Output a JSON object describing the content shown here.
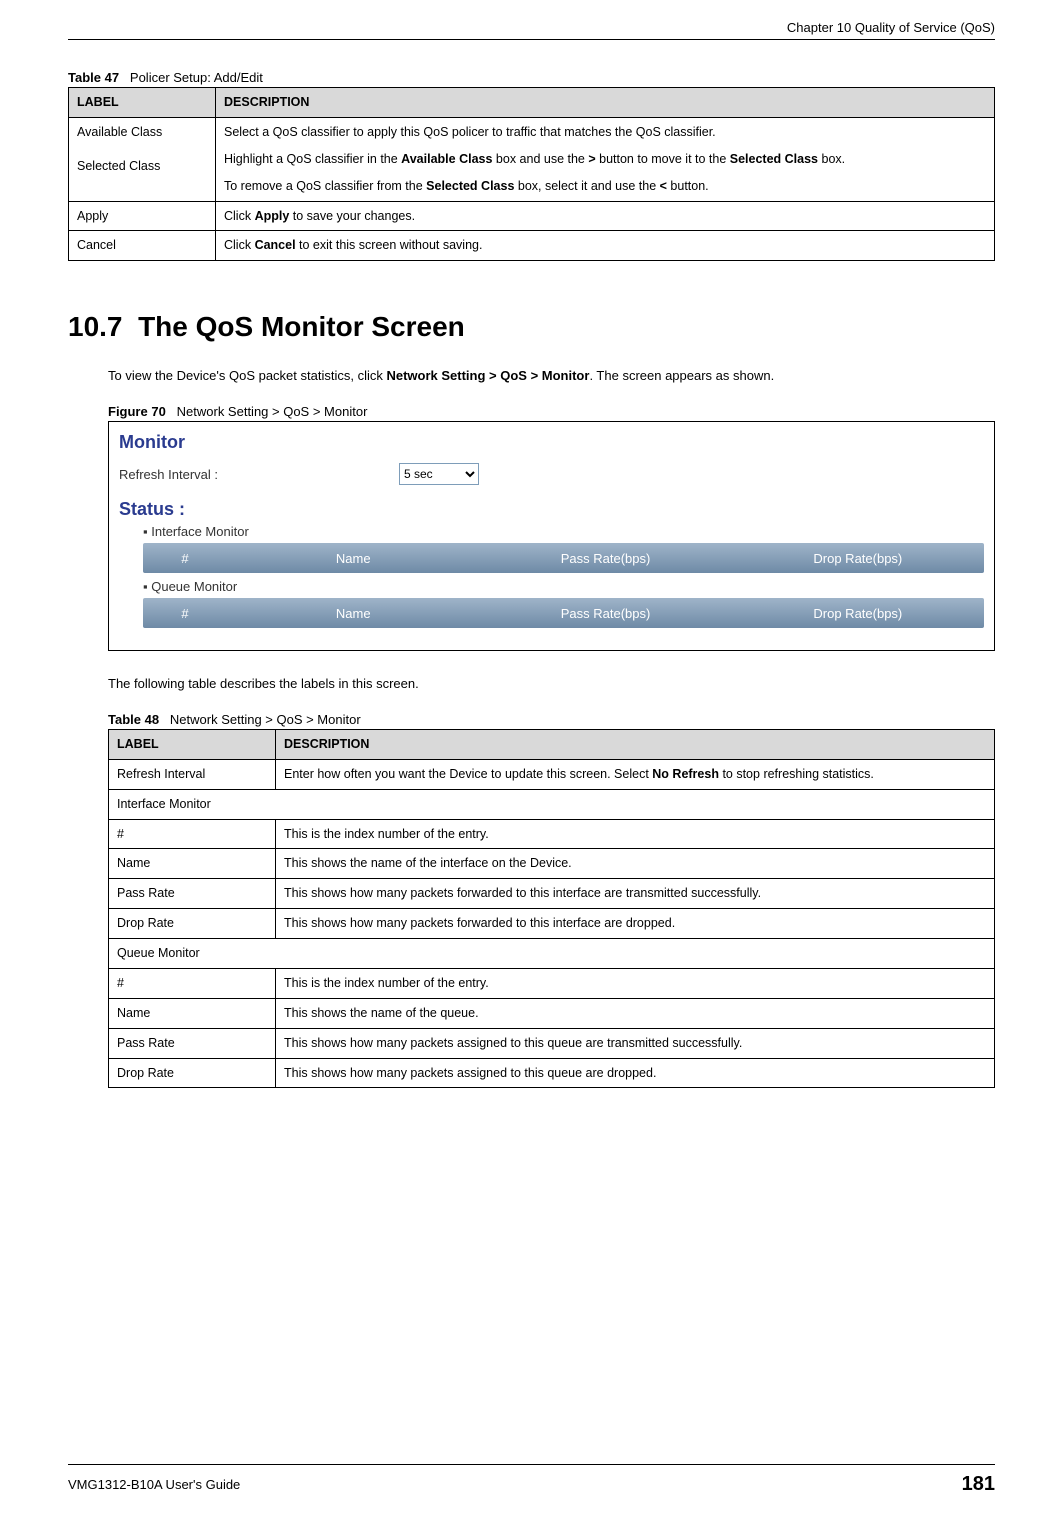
{
  "header": {
    "chapter": "Chapter 10 Quality of Service (QoS)"
  },
  "table47": {
    "caption_prefix": "Table 47",
    "caption_title": "Policer Setup: Add/Edit",
    "head": {
      "label": "LABEL",
      "desc": "DESCRIPTION"
    },
    "rows": {
      "r1": {
        "label1": "Available Class",
        "label2": "Selected Class",
        "p1": "Select a QoS classifier to apply this QoS policer to traffic that matches the QoS classifier.",
        "p2a": "Highlight a QoS classifier in the ",
        "p2b": "Available Class",
        "p2c": " box and use the ",
        "p2d": ">",
        "p2e": " button to move it to the ",
        "p2f": "Selected Class",
        "p2g": " box.",
        "p3a": "To remove a QoS classifier from the ",
        "p3b": "Selected Class",
        "p3c": " box, select it and use the ",
        "p3d": "<",
        "p3e": " button."
      },
      "r2": {
        "label": "Apply",
        "d1": "Click ",
        "d2": "Apply",
        "d3": " to save your changes."
      },
      "r3": {
        "label": "Cancel",
        "d1": "Click ",
        "d2": "Cancel",
        "d3": " to exit this screen without saving."
      }
    }
  },
  "section": {
    "number": "10.7",
    "title": "The QoS Monitor Screen",
    "intro1": "To view the Device's QoS packet statistics, click ",
    "intro_bold": "Network Setting > QoS > Monitor",
    "intro2": ". The screen appears as shown."
  },
  "figure70": {
    "caption_prefix": "Figure 70",
    "caption_title": "Network Setting > QoS > Monitor",
    "window": {
      "title": "Monitor",
      "refresh_label": "Refresh Interval :",
      "refresh_value": "5 sec",
      "status_label": "Status :",
      "interface_monitor": "Interface Monitor",
      "queue_monitor": "Queue Monitor",
      "cols": {
        "hash": "#",
        "name": "Name",
        "pass": "Pass Rate(bps)",
        "drop": "Drop Rate(bps)"
      }
    }
  },
  "body2": "The following table describes the labels in this screen.",
  "table48": {
    "caption_prefix": "Table 48",
    "caption_title": "Network Setting > QoS > Monitor",
    "head": {
      "label": "LABEL",
      "desc": "DESCRIPTION"
    },
    "rows": {
      "r1": {
        "label": "Refresh Interval",
        "d1": "Enter how often you want the Device to update this screen. Select ",
        "d2": "No Refresh",
        "d3": " to stop refreshing statistics."
      },
      "r2": {
        "label": "Interface Monitor"
      },
      "r3": {
        "label": "#",
        "desc": "This is the index number of the entry."
      },
      "r4": {
        "label": "Name",
        "desc": "This shows the name of the interface on the Device."
      },
      "r5": {
        "label": "Pass Rate",
        "desc": "This shows how many packets forwarded to this interface are transmitted successfully."
      },
      "r6": {
        "label": "Drop Rate",
        "desc": "This shows how many packets forwarded to this interface are dropped."
      },
      "r7": {
        "label": "Queue Monitor"
      },
      "r8": {
        "label": "#",
        "desc": "This is the index number of the entry."
      },
      "r9": {
        "label": "Name",
        "desc": "This shows the name of the queue."
      },
      "r10": {
        "label": "Pass Rate",
        "desc": "This shows how many packets assigned to this queue are transmitted successfully."
      },
      "r11": {
        "label": "Drop Rate",
        "desc": "This shows how many packets assigned to this queue are dropped."
      }
    }
  },
  "footer": {
    "guide": "VMG1312-B10A User's Guide",
    "page": "181"
  }
}
